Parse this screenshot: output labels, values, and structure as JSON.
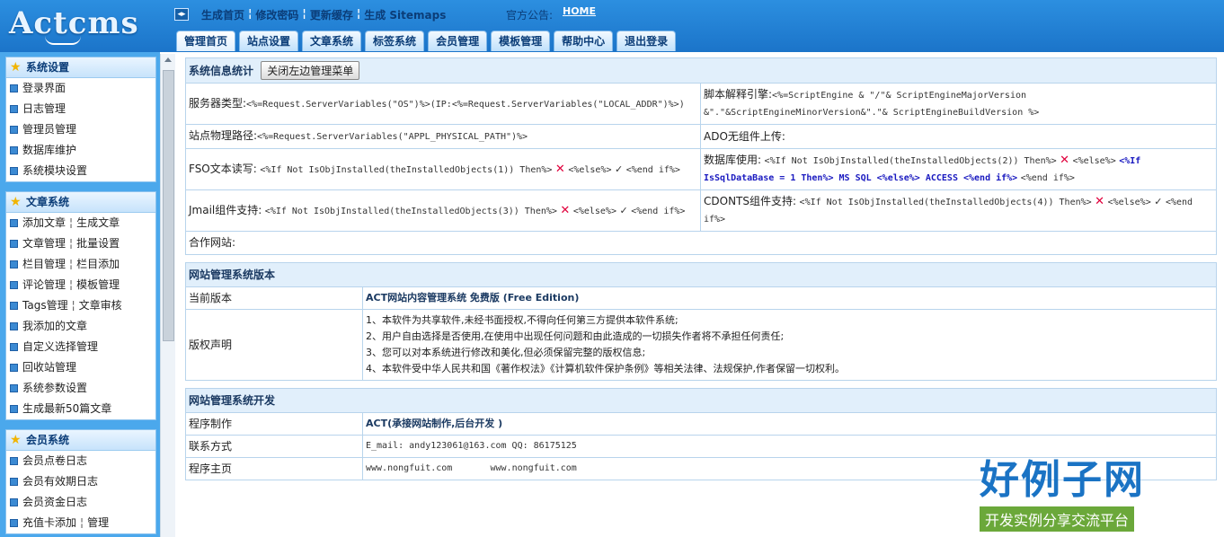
{
  "header": {
    "logo": "Actcms",
    "toplinks": [
      "生成首页",
      "修改密码",
      "更新缓存",
      "生成 Sitemaps"
    ],
    "notice_label": "官方公告:",
    "home_link": "HOME",
    "toggle_icon": "◂▸"
  },
  "tabs": [
    "管理首页",
    "站点设置",
    "文章系统",
    "标签系统",
    "会员管理",
    "模板管理",
    "帮助中心",
    "退出登录"
  ],
  "sidebar": {
    "panel1": {
      "title": "系统设置",
      "items": [
        "登录界面",
        "日志管理",
        "管理员管理",
        "数据库维护",
        "系统模块设置"
      ]
    },
    "panel2": {
      "title": "文章系统",
      "rows": [
        [
          "添加文章",
          "生成文章"
        ],
        [
          "文章管理",
          "批量设置"
        ],
        [
          "栏目管理",
          "栏目添加"
        ],
        [
          "评论管理",
          "模板管理"
        ],
        [
          "Tags管理",
          "文章审核"
        ],
        [
          "我添加的文章"
        ],
        [
          "自定义选择管理"
        ],
        [
          "回收站管理"
        ],
        [
          "系统参数设置"
        ],
        [
          "生成最新50篇文章"
        ]
      ]
    },
    "panel3": {
      "title": "会员系统",
      "rows": [
        [
          "会员点卷日志"
        ],
        [
          "会员有效期日志"
        ],
        [
          "会员资金日志"
        ],
        [
          "充值卡添加",
          "管理"
        ]
      ]
    }
  },
  "sysinfo": {
    "title": "系统信息统计",
    "close_button": "关闭左边管理菜单",
    "server_type_label": "服务器类型:",
    "server_type_value": "<%=Request.ServerVariables(\"OS\")%>(IP:<%=Request.ServerVariables(\"LOCAL_ADDR\")%>)",
    "script_engine_label": "脚本解释引擎:",
    "script_engine_value": "<%=ScriptEngine & \"/\"& ScriptEngineMajorVersion &\".\"&ScriptEngineMinorVersion&\".\"& ScriptEngineBuildVersion %>",
    "physical_path_label": "站点物理路径:",
    "physical_path_value": "<%=Request.ServerVariables(\"APPL_PHYSICAL_PATH\")%>",
    "ado_label": "ADO无组件上传:",
    "fso_label": "FSO文本读写:",
    "fso_pre": "<%If Not IsObjInstalled(theInstalledObjects(1)) Then%>",
    "else": "<%else%>",
    "endif": "<%end if%>",
    "db_label": "数据库使用:",
    "db_pre": "<%If Not IsObjInstalled(theInstalledObjects(2)) Then%>",
    "db_mid": "<%If IsSqlDataBase = 1 Then%> MS SQL <%else%> ACCESS <%end if%>",
    "jmail_label": "Jmail组件支持:",
    "jmail_pre": "<%If Not IsObjInstalled(theInstalledObjects(3)) Then%>",
    "cdonts_label": "CDONTS组件支持:",
    "cdonts_pre": "<%If Not IsObjInstalled(theInstalledObjects(4)) Then%>",
    "partner_label": "合作网站:"
  },
  "version": {
    "title": "网站管理系统版本",
    "current_label": "当前版本",
    "current_value": "ACT网站内容管理系统 免费版 (Free Edition)",
    "copyright_label": "版权声明",
    "copyright_lines": [
      "1、本软件为共享软件,未经书面授权,不得向任何第三方提供本软件系统;",
      "2、用户自由选择是否使用,在使用中出现任何问题和由此造成的一切损失作者将不承担任何责任;",
      "3、您可以对本系统进行修改和美化,但必须保留完整的版权信息;",
      "4、本软件受中华人民共和国《著作权法》《计算机软件保护条例》等相关法律、法规保护,作者保留一切权利。"
    ]
  },
  "dev": {
    "title": "网站管理系统开发",
    "maker_label": "程序制作",
    "maker_value": "ACT(承接网站制作,后台开发 )",
    "contact_label": "联系方式",
    "contact_value": "E_mail: andy123061@163.com QQ: 86175125",
    "homepage_label": "程序主页",
    "homepage_value1": "www.nongfuit.com",
    "homepage_value2": "www.nongfuit.com"
  },
  "watermark": {
    "logo": "好例子网",
    "sub": "开发实例分享交流平台"
  },
  "icons": {
    "star": "★",
    "cross": "✕",
    "check": "✓"
  }
}
